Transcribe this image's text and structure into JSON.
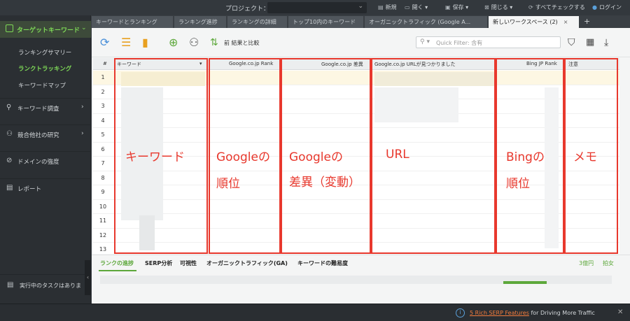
{
  "topbar": {
    "project_label": "プロジェクト：",
    "project_value": "",
    "new_label": "新規",
    "open_label": "開く",
    "save_label": "保存",
    "close_label": "閉じる",
    "check_all_label": "すべてチェックする",
    "login_label": "ログイン"
  },
  "sidebar": {
    "header_label": "ターゲットキーワード",
    "sub_items": [
      {
        "label": "ランキングサマリー"
      },
      {
        "label": "ランクトラッキング"
      },
      {
        "label": "キーワードマップ"
      }
    ],
    "sections": [
      {
        "label": "キーワード調査",
        "icon": "search-icon"
      },
      {
        "label": "競合他社の研究",
        "icon": "people-icon"
      },
      {
        "label": "ドメインの強度",
        "icon": "check-circle-icon"
      },
      {
        "label": "レポート",
        "icon": "report-icon"
      }
    ],
    "task_label": "実行中のタスクはありま"
  },
  "tabs": [
    {
      "label": "キーワードとランキング"
    },
    {
      "label": "ランキング進捗"
    },
    {
      "label": "ランキングの詳細"
    },
    {
      "label": "トップ10内のキーワード"
    },
    {
      "label": "オーガニックトラフィック (Google A..."
    },
    {
      "label": "新しいワークスペース (2)"
    }
  ],
  "toolbar": {
    "compare_label": "前 結果と比較",
    "filter_placeholder": "Quick Filter: 含有"
  },
  "grid": {
    "columns": {
      "num": "#",
      "keyword": "キーワード",
      "google_rank": "Google.co.jp Rank",
      "google_diff": "Google.co.jp 差異",
      "google_url": "Google.co.jp URLが見つかりました",
      "bing_rank": "Bing JP Rank",
      "note": "注意"
    },
    "rows": [
      "1",
      "2",
      "3",
      "4",
      "5",
      "6",
      "7",
      "8",
      "9",
      "10",
      "11",
      "12",
      "13"
    ]
  },
  "annotations": {
    "keyword": "キーワード",
    "google_rank_1": "Googleの",
    "google_rank_2": "順位",
    "google_diff_1": "Googleの",
    "google_diff_2": "差異（変動）",
    "url": "URL",
    "bing_1": "Bingの",
    "bing_2": "順位",
    "memo": "メモ"
  },
  "bottom_tabs": [
    {
      "label": "ランクの進捗"
    },
    {
      "label": "SERP分析"
    },
    {
      "label": "可視性"
    },
    {
      "label": "オーガニックトラフィック(GA)"
    },
    {
      "label": "キーワードの難易度"
    }
  ],
  "bottom_right": {
    "value": "3億円",
    "label": "拍女"
  },
  "status": {
    "link": "5 Rich SERP Features",
    "rest": "for Driving More Traffic"
  },
  "colors": {
    "accent": "#7ed957",
    "annotation": "#e8382d",
    "link": "#f47c3c"
  }
}
